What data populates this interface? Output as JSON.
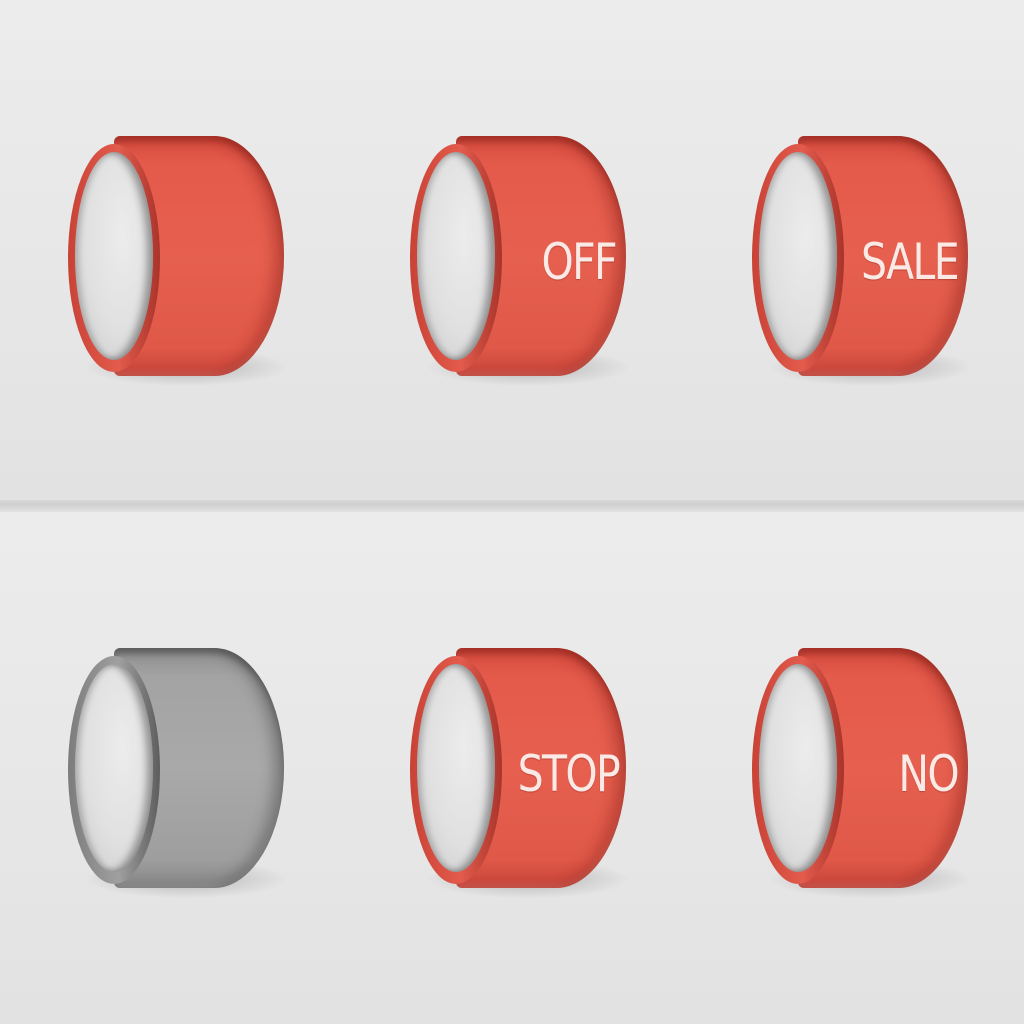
{
  "toggles": [
    {
      "label": "",
      "color": "#e45a4b",
      "state": "blank"
    },
    {
      "label": "OFF",
      "color": "#e45a4b",
      "state": "labeled"
    },
    {
      "label": "SALE",
      "color": "#e45a4b",
      "state": "labeled"
    },
    {
      "label": "",
      "color": "#a3a3a3",
      "state": "disabled"
    },
    {
      "label": "STOP",
      "color": "#e45a4b",
      "state": "labeled"
    },
    {
      "label": "NO",
      "color": "#e45a4b",
      "state": "labeled"
    }
  ],
  "colors": {
    "accent": "#e45a4b",
    "inactive": "#a3a3a3",
    "background": "#e8e8e8",
    "text_on_accent": "#fbe9e6"
  },
  "icons": [
    "toggle-face-icon"
  ]
}
